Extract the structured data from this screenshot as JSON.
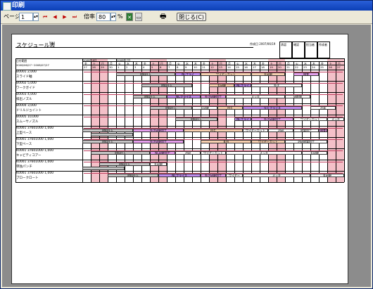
{
  "window": {
    "title": "印刷"
  },
  "toolbar": {
    "page_label": "ページ",
    "page_value": "1",
    "zoom_label": "倍率",
    "zoom_value": "80",
    "zoom_unit": "%",
    "close_label": "閉じる(C)",
    "nav": [
      "⏮",
      "◀",
      "▶",
      "⏭"
    ]
  },
  "paper": {
    "title": "スケジュール表",
    "title_label": "ﾀｲﾄﾙ",
    "created": "作成日 2007/06/19",
    "approvals": [
      "承認",
      "確認",
      "担当者",
      "作成者"
    ],
    "period_label": "日付範囲",
    "period": "2008/06/27~2008/07/27",
    "month_jun": "2008年6月",
    "month_jul": "2008年7月"
  },
  "calendar": {
    "days": [
      {
        "d": "27",
        "w": "金"
      },
      {
        "d": "28",
        "w": "土"
      },
      {
        "d": "29",
        "w": "日"
      },
      {
        "d": "30",
        "w": "月"
      },
      {
        "d": "1",
        "w": "火"
      },
      {
        "d": "2",
        "w": "水"
      },
      {
        "d": "3",
        "w": "木"
      },
      {
        "d": "4",
        "w": "金"
      },
      {
        "d": "5",
        "w": "土"
      },
      {
        "d": "6",
        "w": "日"
      },
      {
        "d": "7",
        "w": "月"
      },
      {
        "d": "8",
        "w": "火"
      },
      {
        "d": "9",
        "w": "水"
      },
      {
        "d": "10",
        "w": "木"
      },
      {
        "d": "11",
        "w": "金"
      },
      {
        "d": "12",
        "w": "土"
      },
      {
        "d": "13",
        "w": "日"
      },
      {
        "d": "14",
        "w": "月"
      },
      {
        "d": "15",
        "w": "火"
      },
      {
        "d": "16",
        "w": "水"
      },
      {
        "d": "17",
        "w": "木"
      },
      {
        "d": "18",
        "w": "金"
      },
      {
        "d": "19",
        "w": "土"
      },
      {
        "d": "20",
        "w": "日"
      },
      {
        "d": "21",
        "w": "月"
      },
      {
        "d": "22",
        "w": "火"
      },
      {
        "d": "23",
        "w": "水"
      },
      {
        "d": "24",
        "w": "木"
      },
      {
        "d": "25",
        "w": "金"
      },
      {
        "d": "26",
        "w": "土"
      },
      {
        "d": "27",
        "w": "日"
      }
    ],
    "weekend_days": [
      1,
      2,
      8,
      9,
      15,
      16,
      22,
      23,
      29,
      30
    ]
  },
  "colors": {
    "gray": "#c6c6c6",
    "magenta": "#e6a0ee",
    "peach": "#f6d0b0",
    "violet": "#c08cf0",
    "pink": "#f4c0c8",
    "white": "#ffffff"
  },
  "rows": [
    {
      "l1": "B0001   2,000",
      "l2": "スライド軸",
      "top": [
        {
          "s": 4,
          "e": 11,
          "t": "材料仕入",
          "c": "gray"
        },
        {
          "s": 11,
          "e": 14,
          "t": "NCフライ",
          "c": "violet"
        },
        {
          "s": 14,
          "e": 20,
          "t": "ワイヤーカット",
          "c": "peach"
        },
        {
          "s": 20,
          "e": 24,
          "t": "丸研磨",
          "c": "peach"
        },
        {
          "s": 25,
          "e": 28,
          "t": "検査",
          "c": "magenta"
        }
      ],
      "bot": []
    },
    {
      "l1": "B0002   5,000",
      "l2": "ワークガイド",
      "top": [
        {
          "s": 7,
          "e": 13,
          "t": "材料仕入",
          "c": "gray"
        },
        {
          "s": 15,
          "e": 18,
          "t": "丸研磨",
          "c": "peach"
        },
        {
          "s": 18,
          "e": 20,
          "t": "NCフライ",
          "c": "violet"
        },
        {
          "s": 20,
          "e": 26,
          "t": "外注",
          "c": "white"
        }
      ],
      "bot": []
    },
    {
      "l1": "B0003   4,000",
      "l2": "排出ノズル",
      "top": [
        {
          "s": 6,
          "e": 10,
          "t": "材料仕入",
          "c": "gray"
        },
        {
          "s": 10,
          "e": 14,
          "t": "NCフライス",
          "c": "violet"
        },
        {
          "s": 14,
          "e": 17,
          "t": "外注研磨加工",
          "c": "magenta"
        },
        {
          "s": 17,
          "e": 24,
          "t": "メッキ",
          "c": "white"
        },
        {
          "s": 24,
          "e": 27,
          "t": "研削盤",
          "c": "white"
        }
      ],
      "bot": []
    },
    {
      "l1": "B0004   3,000",
      "l2": "ドリルジョイント",
      "top": [
        {
          "s": 8,
          "e": 13,
          "t": "材料仕入",
          "c": "gray"
        },
        {
          "s": 13,
          "e": 16,
          "t": "丸研磨",
          "c": "white"
        },
        {
          "s": 16,
          "e": 19,
          "t": "ＭＣ",
          "c": "peach"
        },
        {
          "s": 19,
          "e": 26,
          "t": "ＮＣフライス",
          "c": "violet"
        },
        {
          "s": 27,
          "e": 30,
          "t": "治具",
          "c": "white"
        }
      ],
      "bot": []
    },
    {
      "l1": "B0005   10,000",
      "l2": "スムーサノズル",
      "top": [
        {
          "s": 11,
          "e": 16,
          "t": "材料仕入",
          "c": "gray"
        },
        {
          "s": 18,
          "e": 20,
          "t": "NCフライ",
          "c": "violet"
        },
        {
          "s": 20,
          "e": 25,
          "t": "外注研磨加工",
          "c": "magenta"
        },
        {
          "s": 25,
          "e": 29,
          "t": "ワイヤーカット",
          "c": "white"
        },
        {
          "s": 29,
          "e": 31,
          "t": "メッキ",
          "c": "white"
        }
      ],
      "bot": []
    },
    {
      "l1": "K0001 37601000  1,000",
      "l2": "上型ベース",
      "top": [
        {
          "s": 0,
          "e": 6,
          "t": "材料仕入",
          "c": "gray"
        },
        {
          "s": 6,
          "e": 12,
          "t": "外注研磨加工",
          "c": "magenta"
        },
        {
          "s": 12,
          "e": 19,
          "t": "ＭＣ",
          "c": "peach"
        },
        {
          "s": 19,
          "e": 22,
          "t": "ワイヤーカット",
          "c": "white"
        },
        {
          "s": 22,
          "e": 25,
          "t": "治研",
          "c": "white"
        },
        {
          "s": 25,
          "e": 28,
          "t": "放電加工",
          "c": "white"
        },
        {
          "s": 28,
          "e": 29,
          "t": "検査",
          "c": "magenta"
        }
      ],
      "bot": [
        {
          "s": 1,
          "e": 6,
          "t": "",
          "c": "gray"
        }
      ]
    },
    {
      "l1": "K0001 37601000  1,000",
      "l2": "下型ベース",
      "top": [
        {
          "s": 0,
          "e": 6,
          "t": "材料仕入",
          "c": "gray"
        },
        {
          "s": 6,
          "e": 12,
          "t": "外注研磨加工",
          "c": "magenta"
        },
        {
          "s": 14,
          "e": 20,
          "t": "ＢＭ",
          "c": "peach"
        },
        {
          "s": 20,
          "e": 24,
          "t": "ワイヤーカット",
          "c": "peach"
        },
        {
          "s": 24,
          "e": 29,
          "t": "治研放電加工",
          "c": "white"
        }
      ],
      "bot": []
    },
    {
      "l1": "K0001 37601000  1,000",
      "l2": "キャビティコアー",
      "top": [
        {
          "s": 1,
          "e": 8,
          "t": "材料仕入",
          "c": "gray"
        },
        {
          "s": 8,
          "e": 11,
          "t": "NC研磨加工",
          "c": "magenta"
        },
        {
          "s": 11,
          "e": 14,
          "t": "治研",
          "c": "white"
        },
        {
          "s": 14,
          "e": 17,
          "t": "ワイヤーカット",
          "c": "white"
        },
        {
          "s": 17,
          "e": 26,
          "t": "メッキ",
          "c": "white"
        },
        {
          "s": 26,
          "e": 29,
          "t": "丸研磨",
          "c": "white"
        }
      ],
      "bot": []
    },
    {
      "l1": "K0001 37601000  1,000",
      "l2": "単独パンチ",
      "top": [
        {
          "s": 2,
          "e": 8,
          "t": "材料仕入",
          "c": "gray"
        },
        {
          "s": 8,
          "e": 10,
          "t": "丸研磨",
          "c": "white"
        }
      ],
      "bot": [
        {
          "s": 0,
          "e": 5,
          "t": "",
          "c": "gray"
        }
      ]
    },
    {
      "l1": "K0001 37601000  1,000",
      "l2": "ブロークロート",
      "top": [
        {
          "s": 3,
          "e": 9,
          "t": "材料仕入",
          "c": "gray"
        },
        {
          "s": 9,
          "e": 14,
          "t": "NCフライス",
          "c": "violet"
        },
        {
          "s": 14,
          "e": 17,
          "t": "外注研磨加工",
          "c": "magenta"
        },
        {
          "s": 17,
          "e": 19,
          "t": "ワイヤー",
          "c": "white"
        },
        {
          "s": 19,
          "e": 27,
          "t": "メッキ",
          "c": "white"
        },
        {
          "s": 27,
          "e": 31,
          "t": "丸研磨",
          "c": "white"
        }
      ],
      "bot": []
    }
  ]
}
